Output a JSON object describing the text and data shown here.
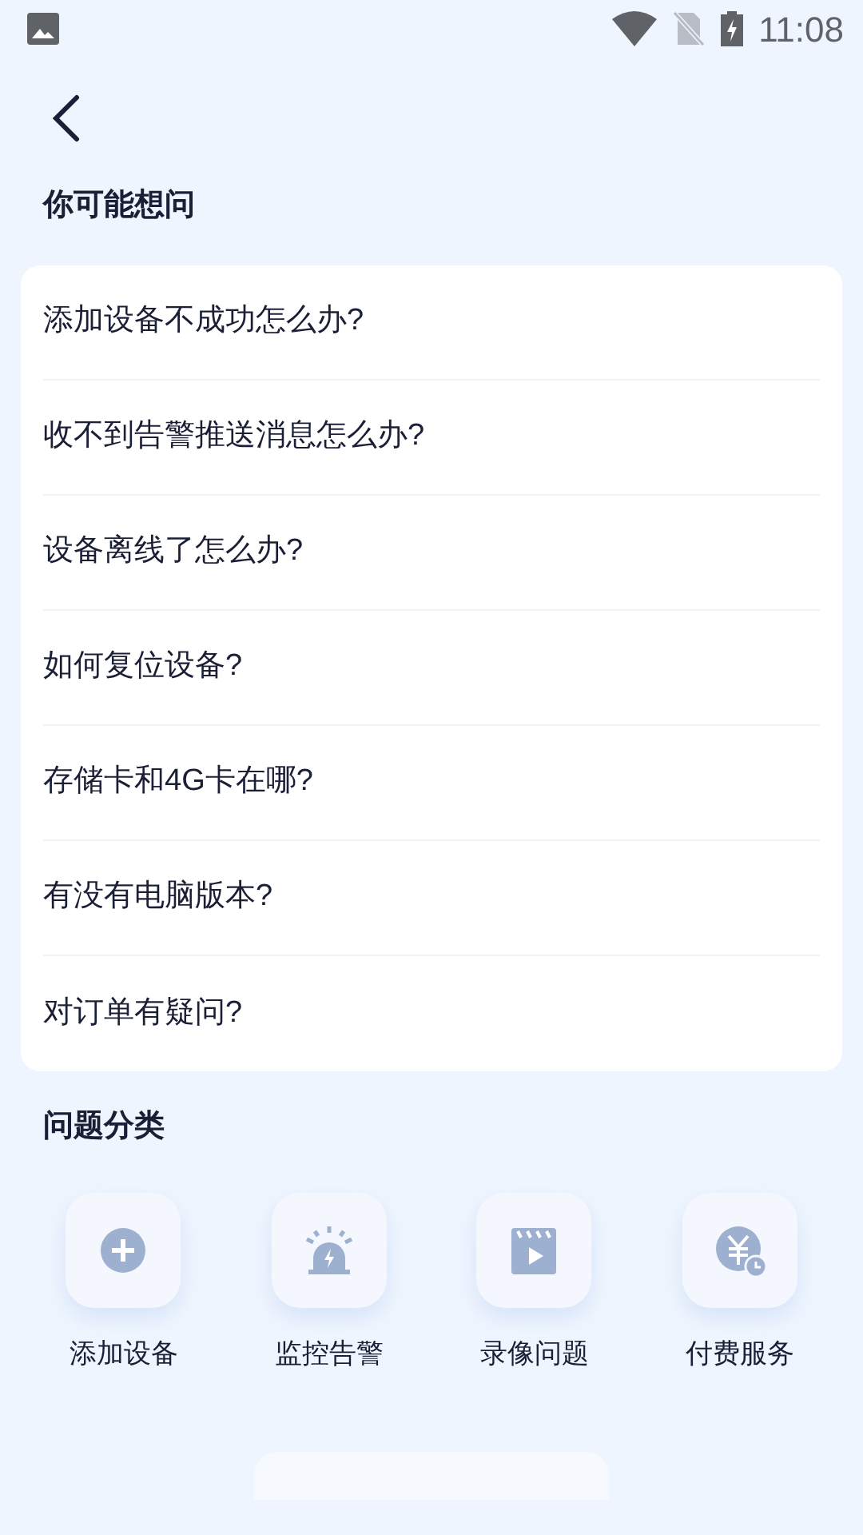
{
  "status_bar": {
    "time": "11:08"
  },
  "faq": {
    "title": "你可能想问",
    "questions": [
      {
        "text": "添加设备不成功怎么办?"
      },
      {
        "text": "收不到告警推送消息怎么办?"
      },
      {
        "text": "设备离线了怎么办?"
      },
      {
        "text": "如何复位设备?"
      },
      {
        "text": "存储卡和4G卡在哪?"
      },
      {
        "text": "有没有电脑版本?"
      },
      {
        "text": "对订单有疑问?"
      }
    ]
  },
  "categories": {
    "title": "问题分类",
    "items": [
      {
        "label": "添加设备",
        "kind": "add"
      },
      {
        "label": "监控告警",
        "kind": "alarm"
      },
      {
        "label": "录像问题",
        "kind": "video"
      },
      {
        "label": "付费服务",
        "kind": "payment"
      }
    ]
  }
}
